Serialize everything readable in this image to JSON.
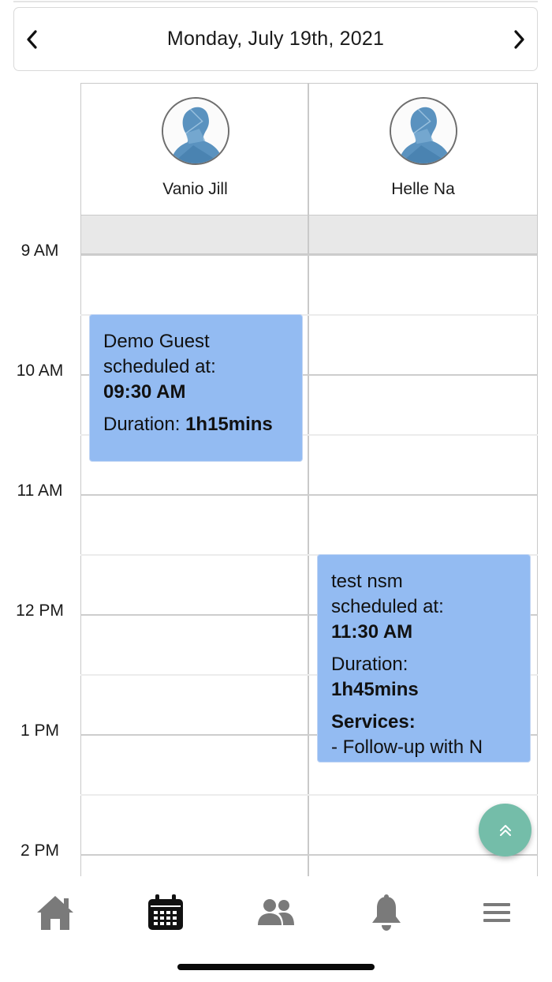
{
  "header": {
    "date_label": "Monday, July 19th, 2021",
    "prev_icon": "chevron-left-icon",
    "next_icon": "chevron-right-icon"
  },
  "resources": [
    {
      "name": "Vanio Jill",
      "avatar_icon": "user-silhouette-avatar"
    },
    {
      "name": "Helle Na",
      "avatar_icon": "user-silhouette-avatar"
    }
  ],
  "time_labels": [
    "9 AM",
    "10 AM",
    "11 AM",
    "12 PM",
    "1 PM",
    "2 PM"
  ],
  "events": [
    {
      "resource": "Vanio Jill",
      "title": "Demo Guest",
      "scheduled_label": "scheduled at:",
      "time": "09:30 AM",
      "duration_label": "Duration:",
      "duration": "1h15mins"
    },
    {
      "resource": "Helle Na",
      "title": "test nsm",
      "scheduled_label": "scheduled at:",
      "time": "11:30 AM",
      "duration_label": "Duration:",
      "duration": "1h45mins",
      "services_label": "Services:",
      "service_item": "- Follow-up with N"
    }
  ],
  "event_color": "#93bbf2",
  "fab": {
    "icon": "double-chevron-up-icon",
    "color": "#74bda9"
  },
  "tabbar": {
    "items": [
      {
        "icon": "home-icon",
        "active": false
      },
      {
        "icon": "calendar-icon",
        "active": true
      },
      {
        "icon": "users-icon",
        "active": false
      },
      {
        "icon": "bell-icon",
        "active": false
      },
      {
        "icon": "menu-icon",
        "active": false
      }
    ],
    "active_color": "#111111",
    "inactive_color": "#7a7a7a"
  }
}
